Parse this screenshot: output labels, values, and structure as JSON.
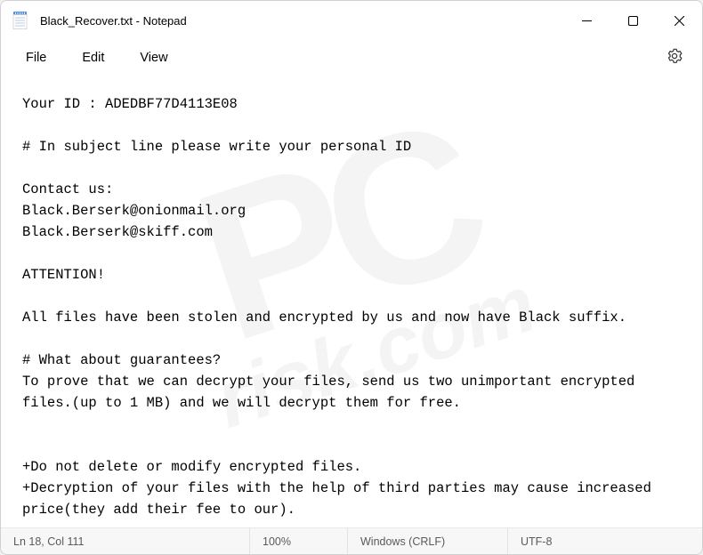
{
  "titlebar": {
    "title": "Black_Recover.txt - Notepad"
  },
  "menu": {
    "file": "File",
    "edit": "Edit",
    "view": "View"
  },
  "content": {
    "text": "Your ID : ADEDBF77D4113E08\n\n# In subject line please write your personal ID\n\nContact us:\nBlack.Berserk@onionmail.org\nBlack.Berserk@skiff.com\n\nATTENTION!\n\nAll files have been stolen and encrypted by us and now have Black suffix.\n\n# What about guarantees?\nTo prove that we can decrypt your files, send us two unimportant encrypted files.(up to 1 MB) and we will decrypt them for free.\n\n\n+Do not delete or modify encrypted files.\n+Decryption of your files with the help of third parties may cause increased price(they add their fee to our)."
  },
  "status": {
    "position": "Ln 18, Col 111",
    "zoom": "100%",
    "eol": "Windows (CRLF)",
    "encoding": "UTF-8"
  },
  "watermark": {
    "line1": "PC",
    "line2": "risk.com"
  }
}
